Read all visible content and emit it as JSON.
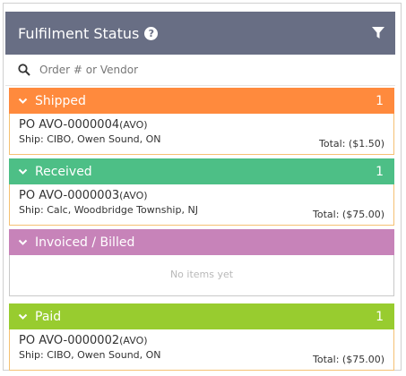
{
  "header": {
    "title": "Fulfilment Status",
    "help_icon": "question-circle-icon",
    "filter_icon": "filter-icon"
  },
  "search": {
    "placeholder": "Order # or Vendor",
    "value": ""
  },
  "groups": [
    {
      "label": "Shipped",
      "count": "1",
      "color": "#ff8a3d",
      "border": "#f5c173",
      "order": {
        "po": "PO AVO-0000004",
        "vendor": "(AVO)",
        "ship": "Ship: CIBO, Owen Sound, ON",
        "total": "Total: ($1.50)"
      }
    },
    {
      "label": "Received",
      "count": "1",
      "color": "#4dbf86",
      "border": "#f5c173",
      "order": {
        "po": "PO AVO-0000003",
        "vendor": "(AVO)",
        "ship": "Ship: Calc, Woodbridge Township, NJ",
        "total": "Total: ($75.00)"
      }
    },
    {
      "label": "Invoiced / Billed",
      "color": "#c783b9",
      "border": "#c9c9c9",
      "empty_text": "No items yet"
    },
    {
      "label": "Paid",
      "count": "1",
      "color": "#98cc2f",
      "border": "#f5c173",
      "order": {
        "po": "PO AVO-0000002",
        "vendor": "(AVO)",
        "ship": "Ship: CIBO, Owen Sound, ON",
        "total": "Total: ($75.00)"
      }
    }
  ]
}
